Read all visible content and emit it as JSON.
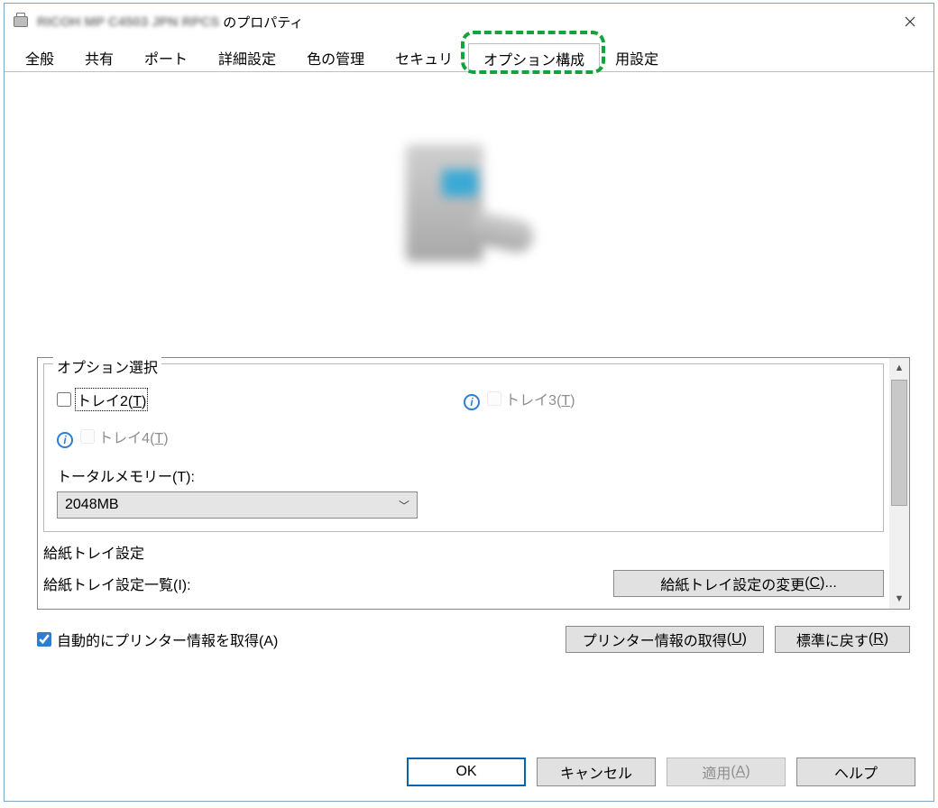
{
  "title": {
    "obscured": "RICOH MP C4503 JPN RPCS",
    "suffix": "のプロパティ"
  },
  "tabs": {
    "general": "全般",
    "share": "共有",
    "port": "ポート",
    "advanced": "詳細設定",
    "color": "色の管理",
    "security": "セキュリ",
    "option": "オプション構成",
    "app": "用設定"
  },
  "options_group": {
    "legend": "オプション選択",
    "tray2": "トレイ2",
    "tray2_acc": "T",
    "tray3": "トレイ3",
    "tray3_acc": "T",
    "tray4": "トレイ4",
    "tray4_acc": "T",
    "memory_label": "トータルメモリー",
    "memory_acc": "T",
    "memory_value": "2048MB"
  },
  "tray_group": {
    "header": "給紙トレイ設定",
    "list_label": "給紙トレイ設定一覧",
    "list_acc": "I",
    "change_btn": "給紙トレイ設定の変更",
    "change_acc": "C"
  },
  "auto_checkbox": {
    "label": "自動的にプリンター情報を取得",
    "acc": "A"
  },
  "info_btn": {
    "label": "プリンター情報の取得",
    "acc": "U"
  },
  "reset_btn": {
    "label": "標準に戻す",
    "acc": "R"
  },
  "dialog": {
    "ok": "OK",
    "cancel": "キャンセル",
    "apply": "適用",
    "apply_acc": "A",
    "help": "ヘルプ"
  }
}
